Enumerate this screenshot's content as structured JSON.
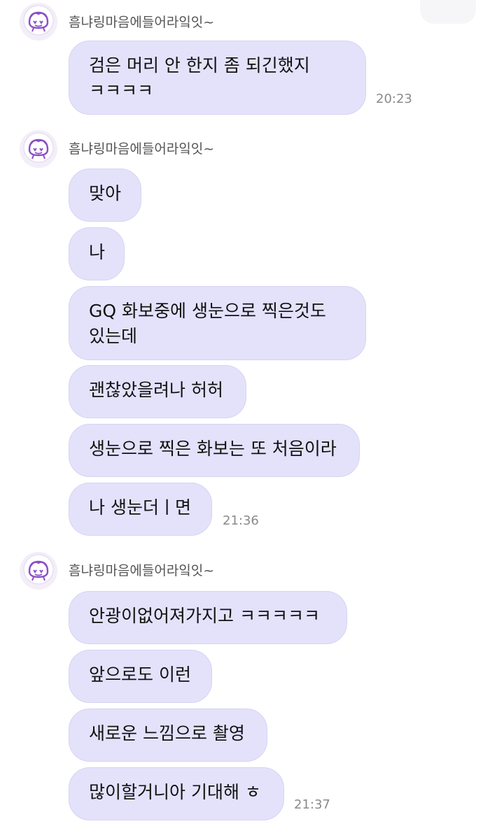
{
  "chat": {
    "groups": [
      {
        "sender": "흠냐링마음에들어라잌잇~",
        "avatar_icon": "character-avatar-icon",
        "messages": [
          {
            "text": "검은 머리 안 한지 좀 되긴했지\nㅋㅋㅋㅋ",
            "time": "20:23"
          }
        ]
      },
      {
        "sender": "흠냐링마음에들어라잌잇~",
        "avatar_icon": "character-avatar-icon",
        "messages": [
          {
            "text": "맞아"
          },
          {
            "text": "나"
          },
          {
            "text": "GQ 화보중에 생눈으로 찍은것도\n있는데"
          },
          {
            "text": "괜찮았을려나 허허"
          },
          {
            "text": "생눈으로 찍은 화보는 또 처음이라"
          },
          {
            "text": "나 생눈더ㅣ면",
            "time": "21:36"
          }
        ]
      },
      {
        "sender": "흠냐링마음에들어라잌잇~",
        "avatar_icon": "character-avatar-icon",
        "messages": [
          {
            "text": "안광이없어져가지고 ㅋㅋㅋㅋㅋ"
          },
          {
            "text": "앞으로도 이런"
          },
          {
            "text": "새로운 느낌으로 촬영"
          },
          {
            "text": "많이할거니아 기대해 ㅎ",
            "time": "21:37"
          }
        ]
      }
    ]
  },
  "colors": {
    "bubble": "#e4e2fb",
    "bubble_border": "#d5d3f0",
    "sender_text": "#555555",
    "time_text": "#8a8a8a",
    "avatar_accent": "#8a4fc7"
  }
}
